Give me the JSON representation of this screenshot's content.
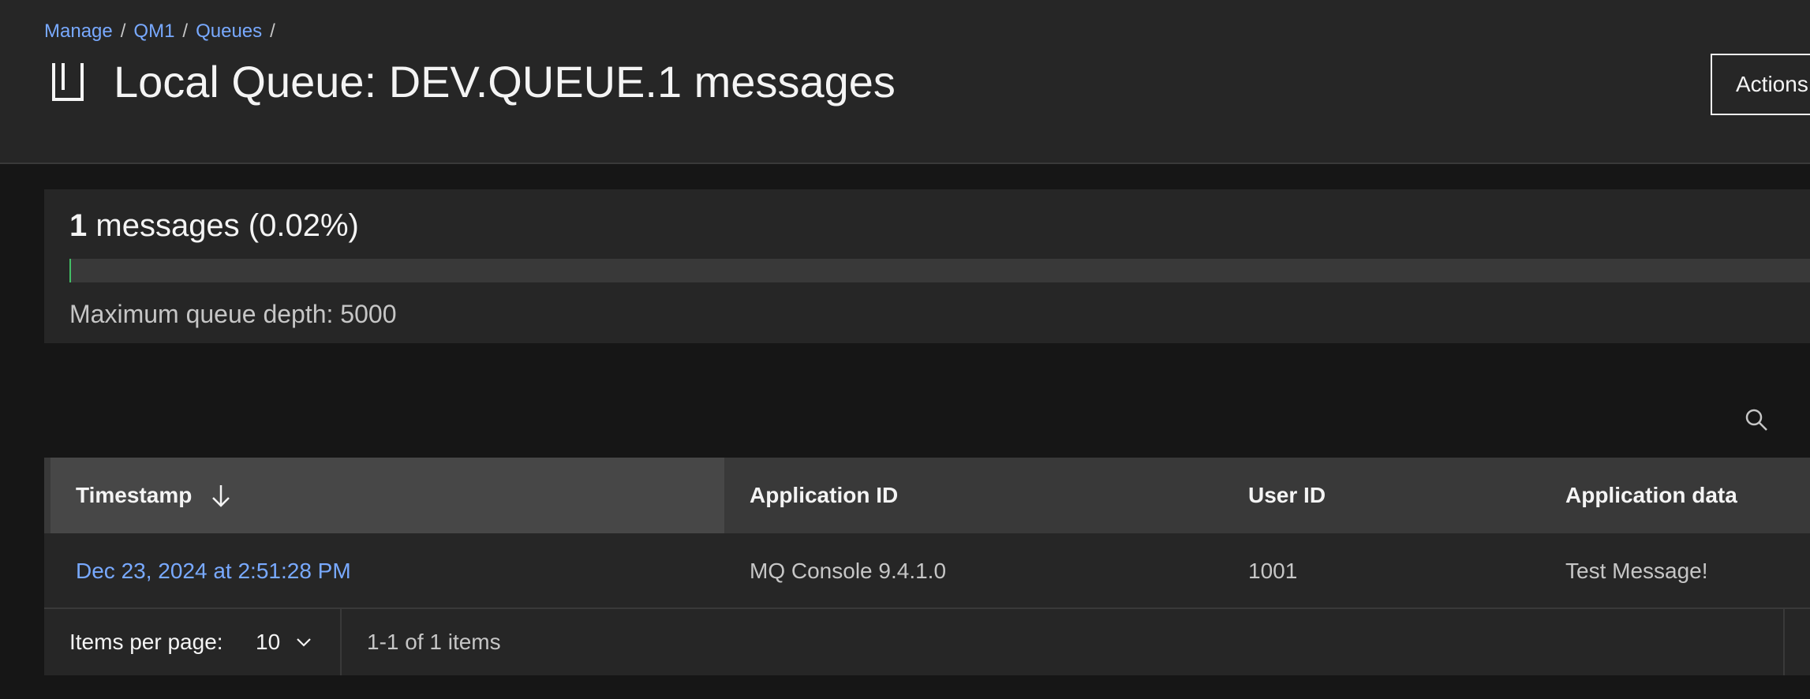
{
  "breadcrumb": {
    "items": [
      {
        "label": "Manage"
      },
      {
        "label": "QM1"
      },
      {
        "label": "Queues"
      }
    ],
    "separator": "/"
  },
  "header": {
    "title": "Local Queue: DEV.QUEUE.1 messages",
    "icon": "queue-icon",
    "actions_label": "Actions"
  },
  "depth": {
    "count": "1",
    "count_suffix": "messages (0.02%)",
    "fill_fraction": 0.0002,
    "max_depth_text": "Maximum queue depth: 5000",
    "fill_color": "#42be65"
  },
  "search": {
    "icon": "search-icon"
  },
  "table": {
    "columns": [
      {
        "label": "Timestamp",
        "sort": "descending"
      },
      {
        "label": "Application ID"
      },
      {
        "label": "User ID"
      },
      {
        "label": "Application data"
      }
    ],
    "rows": [
      {
        "timestamp": "Dec 23, 2024 at 2:51:28 PM",
        "application_id": "MQ Console 9.4.1.0",
        "user_id": "1001",
        "application_data": "Test Message!"
      }
    ]
  },
  "pagination": {
    "items_per_page_label": "Items per page:",
    "page_size": "10",
    "range_text": "1-1 of 1 items"
  },
  "colors": {
    "link": "#78a9ff",
    "background": "#161616",
    "panel": "#262626"
  }
}
